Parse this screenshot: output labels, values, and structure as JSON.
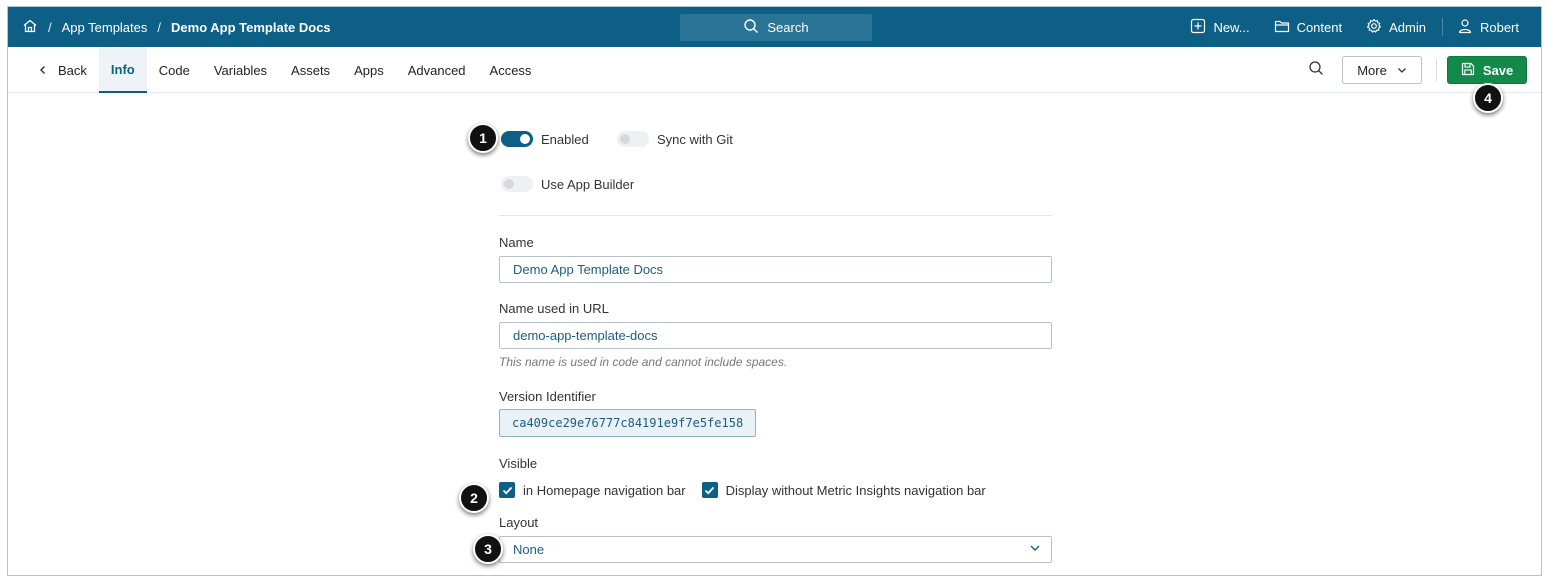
{
  "topbar": {
    "breadcrumb": {
      "parent": "App Templates",
      "current": "Demo App Template Docs"
    },
    "search_label": "Search",
    "new_label": "New...",
    "content_label": "Content",
    "admin_label": "Admin",
    "user_label": "Robert",
    "bg_color": "#0d5f86"
  },
  "tabs": {
    "back_label": "Back",
    "items": [
      "Info",
      "Code",
      "Variables",
      "Assets",
      "Apps",
      "Advanced",
      "Access"
    ],
    "active": "Info",
    "more_label": "More",
    "save_label": "Save",
    "save_color": "#148a4a"
  },
  "form": {
    "enabled_label": "Enabled",
    "enabled": true,
    "sync_git_label": "Sync with Git",
    "sync_git": false,
    "app_builder_label": "Use App Builder",
    "app_builder": false,
    "name_label": "Name",
    "name_value": "Demo App Template Docs",
    "url_name_label": "Name used in URL",
    "url_name_value": "demo-app-template-docs",
    "url_name_hint": "This name is used in code and cannot include spaces.",
    "version_label": "Version Identifier",
    "version_value": "ca409ce29e76777c84191e9f7e5fe158",
    "visible_label": "Visible",
    "visible_homepage_label": "in Homepage navigation bar",
    "visible_homepage": true,
    "visible_no_mi_label": "Display without Metric Insights navigation bar",
    "visible_no_mi": true,
    "layout_label": "Layout",
    "layout_value": "None"
  },
  "markers": [
    "1",
    "2",
    "3",
    "4"
  ]
}
